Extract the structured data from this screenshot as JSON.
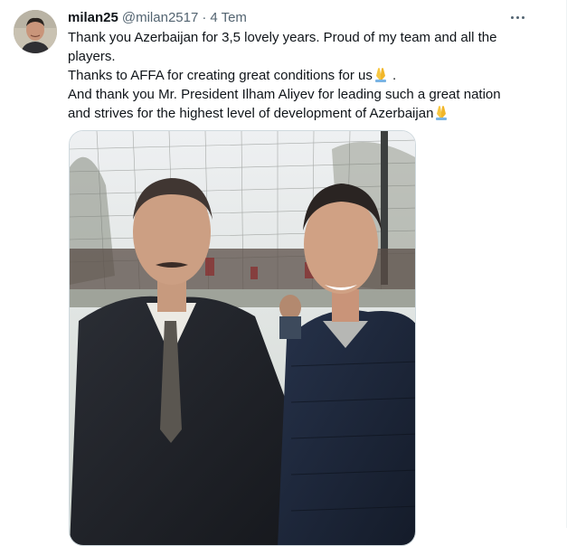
{
  "tweet": {
    "display_name": "milan25",
    "handle": "@milan2517",
    "separator": "·",
    "timestamp": "4 Tem",
    "more_icon": "more-horizontal-icon",
    "lines": [
      "Thank you Azerbaijan for 3,5 lovely years. Proud of my team and all the players.",
      "Thanks to AFFA for creating great conditions for us",
      "And thank you Mr. President Ilham Aliyev for leading such a great nation and strives for the highest level of development of Azerbaijan"
    ],
    "line2_suffix": " .",
    "emoji_icon": "folded-hands-emoji-icon"
  },
  "colors": {
    "text_primary": "#0f1419",
    "text_secondary": "#536471",
    "border": "#cfd9de"
  }
}
